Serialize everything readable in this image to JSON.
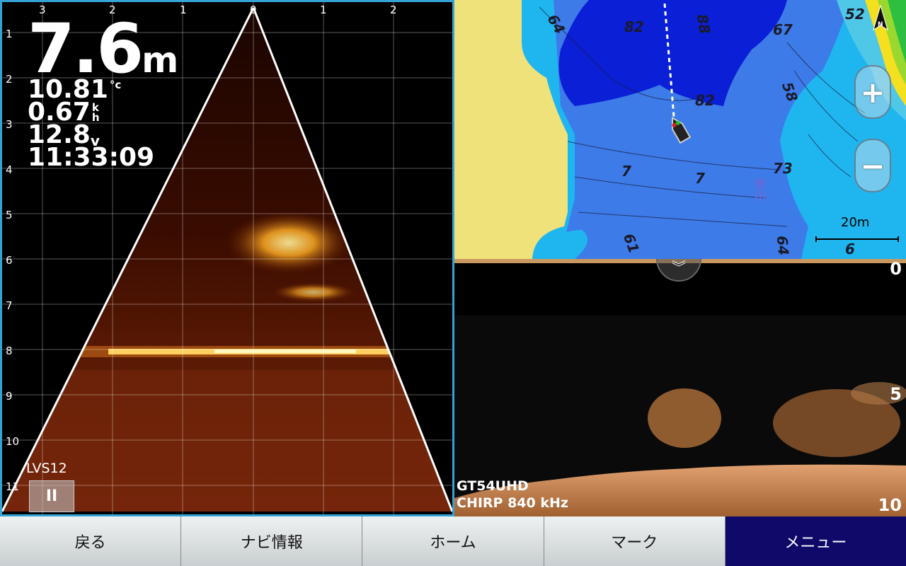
{
  "livescope": {
    "depth_value": "7.6",
    "depth_unit": "m",
    "temperature_value": "10.81",
    "temperature_unit": "°c",
    "speed_value": "0.67",
    "speed_unit_top": "k",
    "speed_unit_bottom": "h",
    "voltage_value": "12.8",
    "voltage_unit": "v",
    "time": "11:33:09",
    "mode_label": "LVS12",
    "pause_label": "II",
    "horizontal_scale": [
      "3",
      "2",
      "1",
      "0",
      "1",
      "2"
    ],
    "vertical_scale": [
      "1",
      "2",
      "3",
      "4",
      "5",
      "6",
      "7",
      "8",
      "9",
      "10",
      "11"
    ]
  },
  "chart": {
    "zoom_in_label": "+",
    "zoom_out_label": "−",
    "north_label": "N",
    "scale_label": "20m",
    "contour_labels": [
      "64",
      "82",
      "88",
      "67",
      "52",
      "58",
      "82",
      "7",
      "7",
      "73",
      "笹川",
      "61",
      "64",
      "6"
    ]
  },
  "sonar": {
    "collapse_label": "︾",
    "scale_top": "0",
    "scale_mid": "5",
    "scale_bottom": "10",
    "transducer": "GT54UHD",
    "frequency": "CHIRP 840 kHz"
  },
  "softkeys": [
    "戻る",
    "ナビ情報",
    "ホーム",
    "マーク",
    "メニュー"
  ],
  "colors": {
    "panel_border": "#35a3d6",
    "menu_active": "#0f0a6a",
    "land": "#f0e27a",
    "deep_water": "#0a1fd6",
    "mid_water": "#3d7be8",
    "shallow_water": "#1fb6f0"
  }
}
